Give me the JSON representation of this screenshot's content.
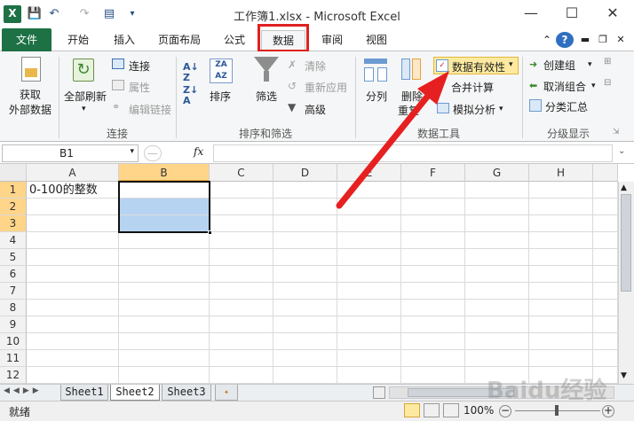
{
  "window": {
    "title": "工作簿1.xlsx - Microsoft Excel",
    "controls": {
      "minimize": "—",
      "maximize": "☐",
      "close": "✕"
    }
  },
  "quick_access": {
    "save_icon": "save-icon",
    "undo_icon": "undo-icon",
    "redo_icon": "redo-icon",
    "custom_icon": "customize-icon"
  },
  "tabs": [
    {
      "label": "文件"
    },
    {
      "label": "开始"
    },
    {
      "label": "插入"
    },
    {
      "label": "页面布局"
    },
    {
      "label": "公式"
    },
    {
      "label": "数据"
    },
    {
      "label": "审阅"
    },
    {
      "label": "视图"
    }
  ],
  "ribbon": {
    "get_external_line1": "获取",
    "get_external_line2": "外部数据",
    "refresh_all": "全部刷新",
    "connections": "连接",
    "properties": "属性",
    "edit_links": "编辑链接",
    "sort": "排序",
    "filter": "筛选",
    "clear": "清除",
    "reapply": "重新应用",
    "advanced": "高级",
    "text_to_columns": "分列",
    "remove_dup": "删除",
    "remove_dup2": "重复",
    "data_validation": "数据有效性",
    "consolidate": "合并计算",
    "what_if": "模拟分析",
    "group": "创建组",
    "ungroup": "取消组合",
    "subtotal": "分类汇总",
    "groups": {
      "connections": "连接",
      "sort_filter": "排序和筛选",
      "data_tools": "数据工具",
      "outline": "分级显示"
    }
  },
  "formula_bar": {
    "name_box": "B1",
    "fx": "fx",
    "value": ""
  },
  "columns": [
    "A",
    "B",
    "C",
    "D",
    "E",
    "F",
    "G",
    "H"
  ],
  "rows": [
    "1",
    "2",
    "3",
    "4",
    "5",
    "6",
    "7",
    "8",
    "9",
    "10",
    "11",
    "12"
  ],
  "cells": {
    "A1": "0-100的整数"
  },
  "sheets": [
    "Sheet1",
    "Sheet2",
    "Sheet3"
  ],
  "status": {
    "ready": "就绪",
    "zoom": "100%"
  },
  "colors": {
    "excel_green": "#1e7145",
    "highlight": "#e02020",
    "selection": "#b7d3f2"
  },
  "watermark": "Baidu经验"
}
